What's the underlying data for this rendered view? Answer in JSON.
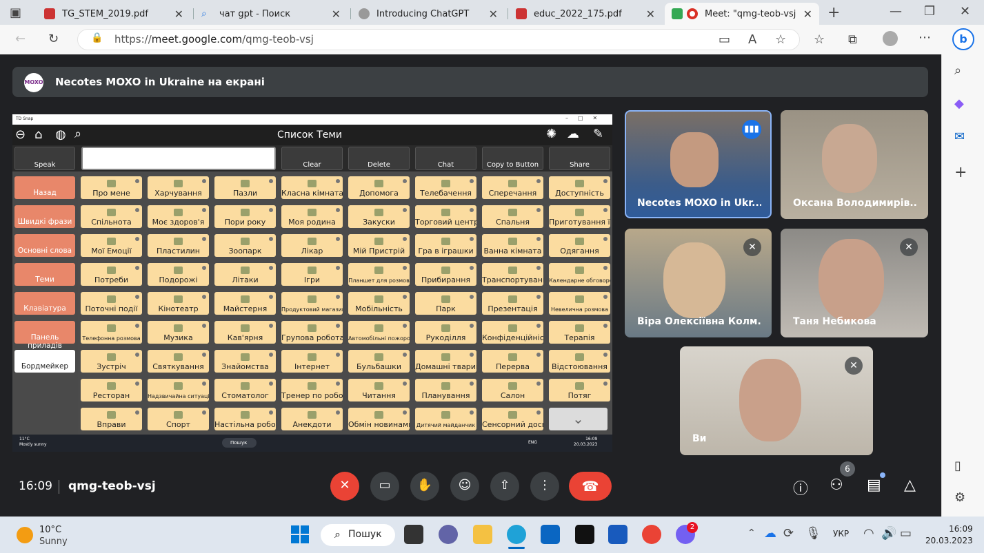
{
  "browser": {
    "tabs": [
      {
        "title": "TG_STEM_2019.pdf"
      },
      {
        "title": "чат gpt - Поиск"
      },
      {
        "title": "Introducing ChatGPT"
      },
      {
        "title": "educ_2022_175.pdf"
      },
      {
        "title": "Meet: \"qmg-teob-vsj"
      }
    ],
    "url_prefix": "https://",
    "url_host": "meet.google.com",
    "url_path": "/qmg-teob-vsj"
  },
  "banner": {
    "logo": "MOXO",
    "text": "Necotes MOXO in Ukraine на екрані"
  },
  "td": {
    "window_title": "TD Snap",
    "topic_title": "Список Теми",
    "toolbar": [
      "Speak",
      "Clear",
      "Delete",
      "Chat",
      "Copy to Button",
      "Share"
    ],
    "nav": [
      "Назад",
      "Швидкі фрази",
      "Основні слова",
      "Теми",
      "Клавіатура",
      "Панель приладів",
      "Бордмейкер"
    ],
    "grid": [
      [
        "Про мене",
        "Харчування",
        "Пазли",
        "Класна кімната",
        "Допомога",
        "Телебачення",
        "Сперечання",
        "Доступність"
      ],
      [
        "Спільнота",
        "Моє здоров'я",
        "Пори року",
        "Моя родина",
        "Закуски",
        "Торговий центр",
        "Спальня",
        "Приготування їжі"
      ],
      [
        "Мої Емоції",
        "Пластилин",
        "Зоопарк",
        "Лікар",
        "Мій Пристрій",
        "Гра в іграшки",
        "Ванна кімната",
        "Одягання"
      ],
      [
        "Потреби",
        "Подорожі",
        "Літаки",
        "Ігри",
        "Планшет для розмов",
        "Прибирання",
        "Транспортування",
        "Календарне обговорення"
      ],
      [
        "Поточні події",
        "Кінотеатр",
        "Майстерня",
        "Продуктовий магазин",
        "Мобільність",
        "Парк",
        "Презентація",
        "Невелична розмова"
      ],
      [
        "Телефонна розмова",
        "Музика",
        "Кав'ярня",
        "Групова робота",
        "Автомобільні пожорожі",
        "Рукоділля",
        "Конфіденційність",
        "Терапія"
      ],
      [
        "Зустріч",
        "Святкування",
        "Знайомства",
        "Інтернет",
        "Бульбашки",
        "Домашні тварини",
        "Перерва",
        "Відстоювання"
      ],
      [
        "Ресторан",
        "Надзвичайна ситуація",
        "Стоматолог",
        "Тренер по роботі",
        "Читання",
        "Планування",
        "Салон",
        "Потяг"
      ],
      [
        "Вправи",
        "Спорт",
        "Настільна робота",
        "Анекдоти",
        "Обмін новинами",
        "Дитячий майданчик",
        "Сенсорний досвід",
        ""
      ]
    ],
    "small_cells": [
      "Планшет для розмов",
      "Календарне обговорення",
      "Продуктовий магазин",
      "Невелична розмова",
      "Телефонна розмова",
      "Автомобільні пожорожі",
      "Надзвичайна ситуація",
      "Дитячий майданчик"
    ],
    "inner_taskbar": {
      "weather_temp": "11°C",
      "weather_text": "Mostly sunny",
      "search": "Пошук",
      "lang": "ENG",
      "time": "16:09",
      "date": "20.03.2023"
    }
  },
  "participants": [
    {
      "name": "Necotes MOXO in Ukr...",
      "speaking": true
    },
    {
      "name": "Оксана Володимирів...",
      "muted": false
    },
    {
      "name": "Віра Олексіївна Колм...",
      "muted": true
    },
    {
      "name": "Таня Небикова",
      "muted": true
    },
    {
      "name": "Ви",
      "muted": true
    }
  ],
  "meeting": {
    "time": "16:09",
    "code": "qmg-teob-vsj",
    "people_count": "6"
  },
  "colors": {
    "end_call": "#ea4335",
    "mic_off": "#ea4335",
    "speaking_border": "#8ab4f8",
    "cell": "#fbdca0",
    "nav": "#e8876a"
  },
  "taskbar": {
    "temp": "10°C",
    "weather": "Sunny",
    "search": "Пошук",
    "lang": "УКР",
    "time": "16:09",
    "date": "20.03.2023",
    "viber_badge": "2"
  }
}
